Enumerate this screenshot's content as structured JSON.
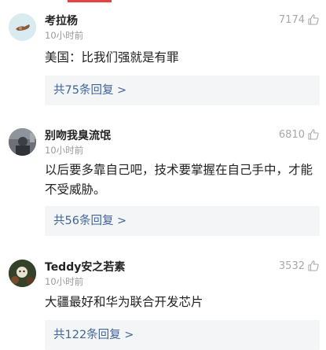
{
  "comments": [
    {
      "username": "考拉杨",
      "time": "10小时前",
      "likes": "7174",
      "content": "美国：比我们强就是有罪",
      "replies": "共75条回复 >"
    },
    {
      "username": "别吻我臭流氓",
      "time": "10小时前",
      "likes": "6810",
      "content": "以后要多靠自己吧，技术要掌握在自己手中，才能不受威胁。",
      "replies": "共56条回复 >"
    },
    {
      "username": "Teddy安之若素",
      "time": "10小时前",
      "likes": "3532",
      "content": "大疆最好和华为联合开发芯片",
      "replies": "共122条回复 >"
    }
  ],
  "colors": {
    "accent": "#e24444",
    "link": "#406599",
    "meta": "#999999"
  },
  "icons": [
    "thumbs-up-icon",
    "avatar-image"
  ]
}
